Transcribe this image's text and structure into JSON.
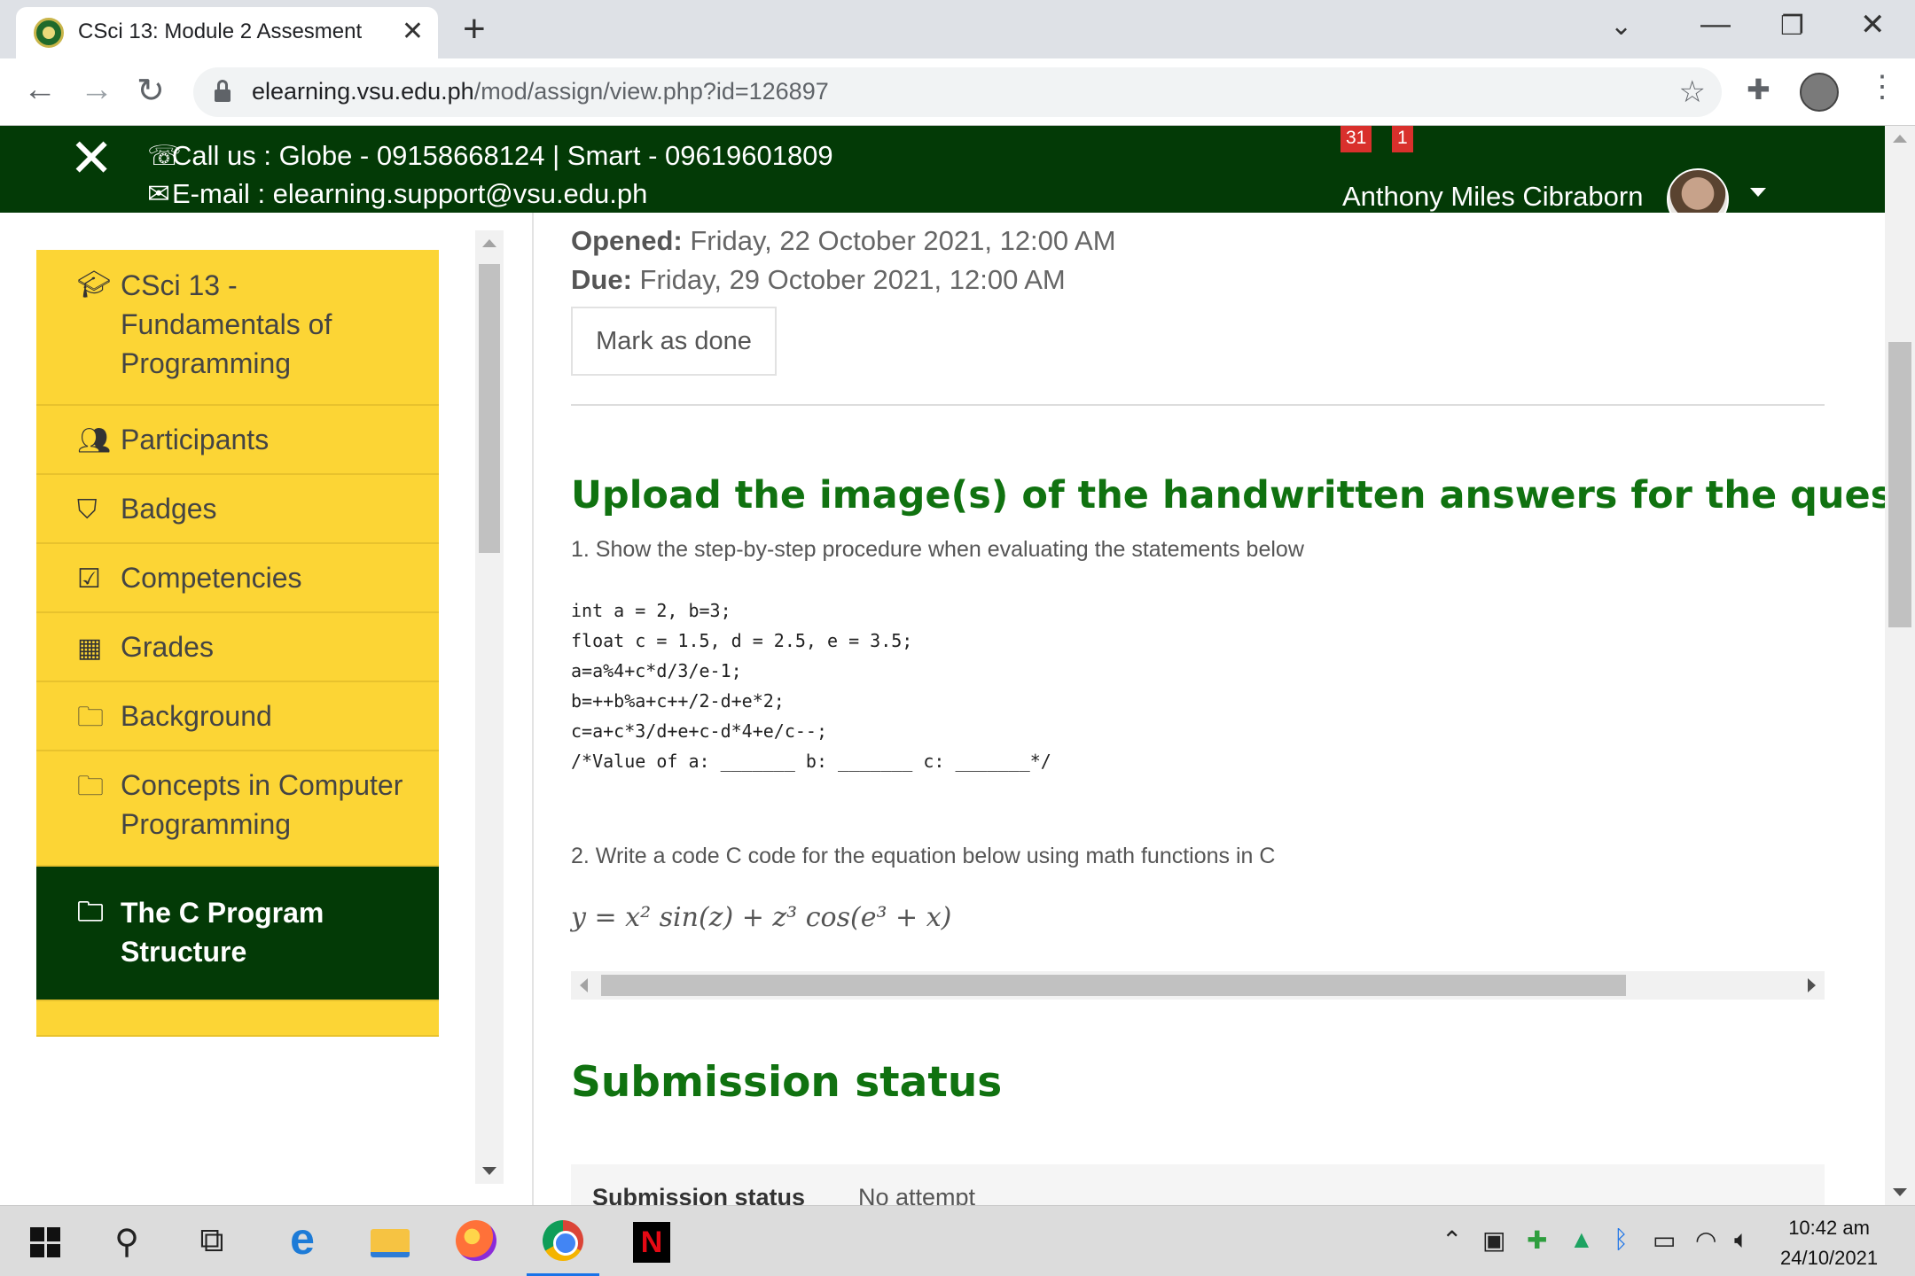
{
  "browser": {
    "tab_title": "CSci 13: Module 2 Assesment",
    "new_tab": "+",
    "url_host": "elearning.vsu.edu.ph",
    "url_path": "/mod/assign/view.php?id=126897"
  },
  "header": {
    "phone": "Call us : Globe - 09158668124 | Smart - 09619601809",
    "email": "E-mail : elearning.support@vsu.edu.ph",
    "notifications_count": "31",
    "messages_count": "1",
    "username": "Anthony Miles Cibraborn",
    "brand_color": "#033a06"
  },
  "drawer": {
    "item_color": "#fcd535",
    "items": [
      {
        "icon": "graduation-cap-icon",
        "label": "CSci 13 - Fundamentals of Programming"
      },
      {
        "icon": "users-icon",
        "label": "Participants"
      },
      {
        "icon": "shield-icon",
        "label": "Badges"
      },
      {
        "icon": "check-square-icon",
        "label": "Competencies"
      },
      {
        "icon": "table-icon",
        "label": "Grades"
      },
      {
        "icon": "folder-icon",
        "label": "Background"
      },
      {
        "icon": "folder-icon",
        "label": "Concepts in Computer Programming"
      },
      {
        "icon": "folder-icon",
        "label": "The C Program Structure",
        "active": true
      }
    ]
  },
  "assignment": {
    "opened_label": "Opened:",
    "opened_value": "Friday, 22 October 2021, 12:00 AM",
    "due_label": "Due:",
    "due_value": "Friday, 29 October 2021, 12:00 AM",
    "mark_done": "Mark as done",
    "instructions_title": "Upload the image(s) of the handwritten answers for the questio",
    "q1": "1. Show the step-by-step procedure when evaluating the statements below",
    "code": [
      "int a = 2, b=3;",
      "float c = 1.5, d = 2.5, e = 3.5;",
      "a=a%4+c*d/3/e-1;",
      "b=++b%a+c++/2-d+e*2;",
      "c=a+c*3/d+e+c-d*4+e/c--;",
      "/*Value of a: _______ b: _______ c: _______*/"
    ],
    "q2": "2. Write a code C code for the equation below using math functions in C",
    "formula": "y = x² sin(z) + z³ cos(e³ + x)",
    "title_color": "#107210"
  },
  "submission": {
    "title": "Submission status",
    "row_label": "Submission status",
    "row_value": "No attempt"
  },
  "taskbar": {
    "time": "10:42 am",
    "date": "24/10/2021"
  }
}
